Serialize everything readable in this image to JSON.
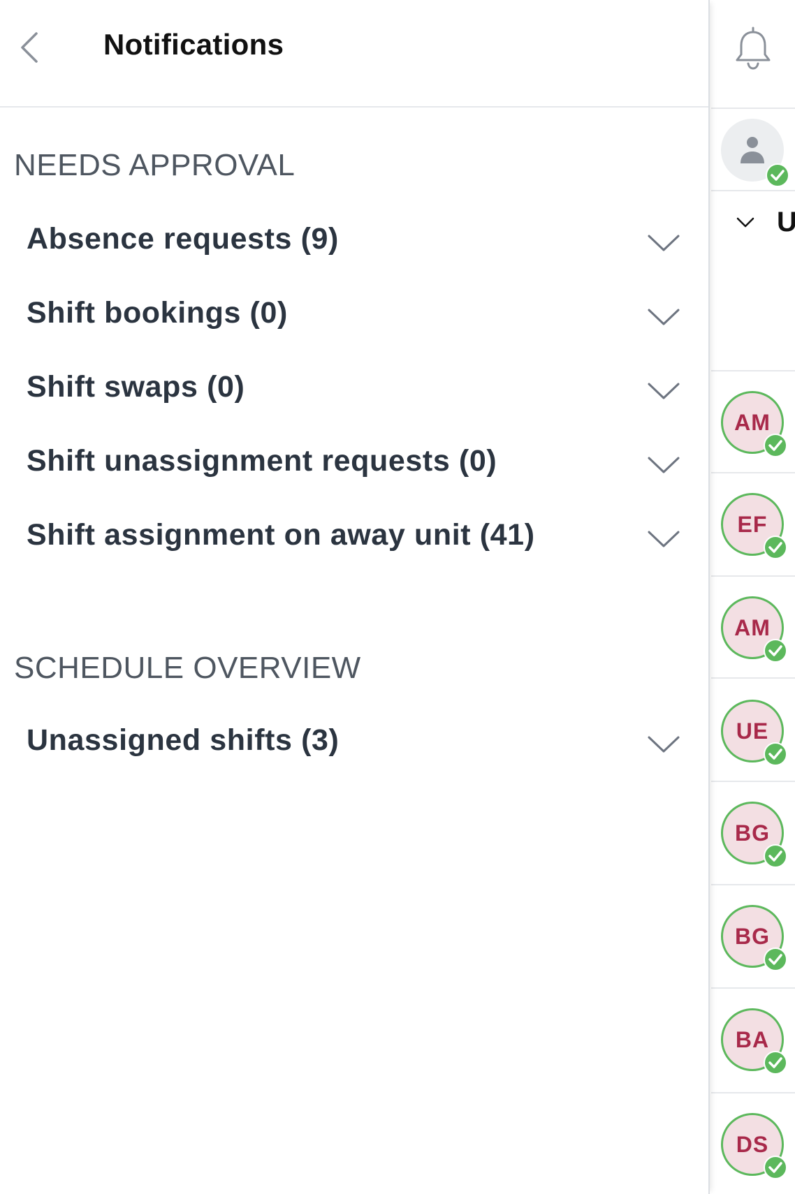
{
  "header": {
    "title": "Notifications"
  },
  "needs_approval": {
    "title": "NEEDS APPROVAL",
    "items": [
      {
        "label": "Absence requests (9)"
      },
      {
        "label": "Shift bookings (0)"
      },
      {
        "label": "Shift swaps (0)"
      },
      {
        "label": "Shift unassignment requests (0)"
      },
      {
        "label": "Shift assignment on away unit (41)"
      }
    ]
  },
  "schedule_overview": {
    "title": "SCHEDULE OVERVIEW",
    "items": [
      {
        "label": "Unassigned shifts (3)"
      }
    ]
  },
  "peek": {
    "group_label": "Ur",
    "avatars": [
      "AM",
      "EF",
      "AM",
      "UE",
      "BG",
      "BG",
      "BA",
      "DS"
    ]
  },
  "colors": {
    "avatar_bg": "#f3dfe3",
    "avatar_text": "#a8294a",
    "status_green": "#5cb85c",
    "heading_gray": "#4e5660",
    "row_text": "#2b3440"
  },
  "icons": {
    "back": "chevron-left-icon",
    "bell": "bell-icon",
    "expand": "chevron-down-icon",
    "check": "check-badge-icon",
    "person": "person-icon"
  }
}
